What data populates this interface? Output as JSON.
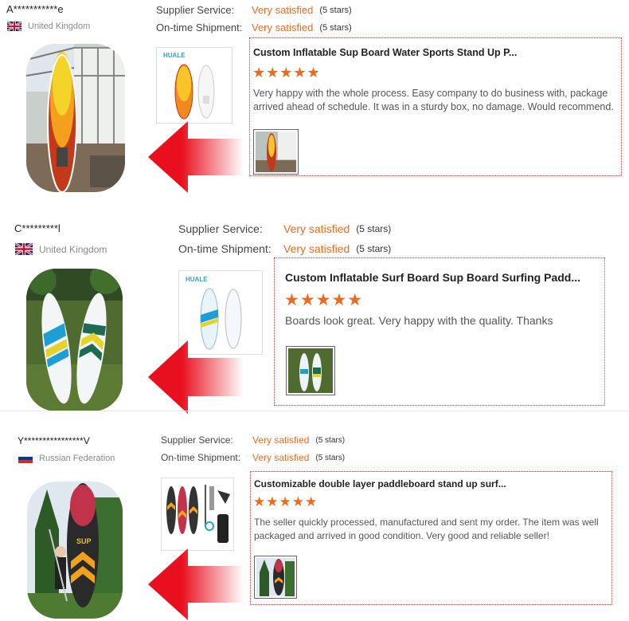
{
  "labels": {
    "supplier_service": "Supplier Service:",
    "ontime_shipment": "On-time Shipment:"
  },
  "colors": {
    "accent": "#f06a1b",
    "arrow": "#e8101e",
    "box_border": "#cc3333"
  },
  "reviews": [
    {
      "buyer": "A***********e",
      "country": "United Kingdom",
      "flag_icon": "uk-flag-icon",
      "supplier_rating": "Very satisfied",
      "supplier_stars": "(5 stars)",
      "shipment_rating": "Very satisfied",
      "shipment_stars": "(5 stars)",
      "product_title": "Custom Inflatable Sup Board Water Sports Stand Up P...",
      "rating": 5,
      "stars": "★★★★★",
      "text": "Very happy with the whole process. Easy company to do business with, package arrived ahead of schedule. It was in a sturdy box, no damage. Would recommend.",
      "brand": "HUALE"
    },
    {
      "buyer": "C*********l",
      "country": "United Kingdom",
      "flag_icon": "uk-flag-icon",
      "supplier_rating": "Very satisfied",
      "supplier_stars": "(5 stars)",
      "shipment_rating": "Very satisfied",
      "shipment_stars": "(5 stars)",
      "product_title": "Custom Inflatable Surf Board Sup Board Surfing Padd...",
      "rating": 5,
      "stars": "★★★★★",
      "text": "Boards look great. Very happy with the quality. Thanks",
      "brand": "HUALE"
    },
    {
      "buyer": "Y****************V",
      "country": "Russian Federation",
      "flag_icon": "russia-flag-icon",
      "supplier_rating": "Very satisfied",
      "supplier_stars": "(5 stars)",
      "shipment_rating": "Very satisfied",
      "shipment_stars": "(5 stars)",
      "product_title": "Customizable double layer paddleboard stand up surf...",
      "rating": 5,
      "stars": "★★★★★",
      "text": "The seller quickly processed, manufactured and sent my order.  The item was well packaged and arrived in good condition.  Very good and reliable seller!",
      "brand": "SUP"
    }
  ]
}
